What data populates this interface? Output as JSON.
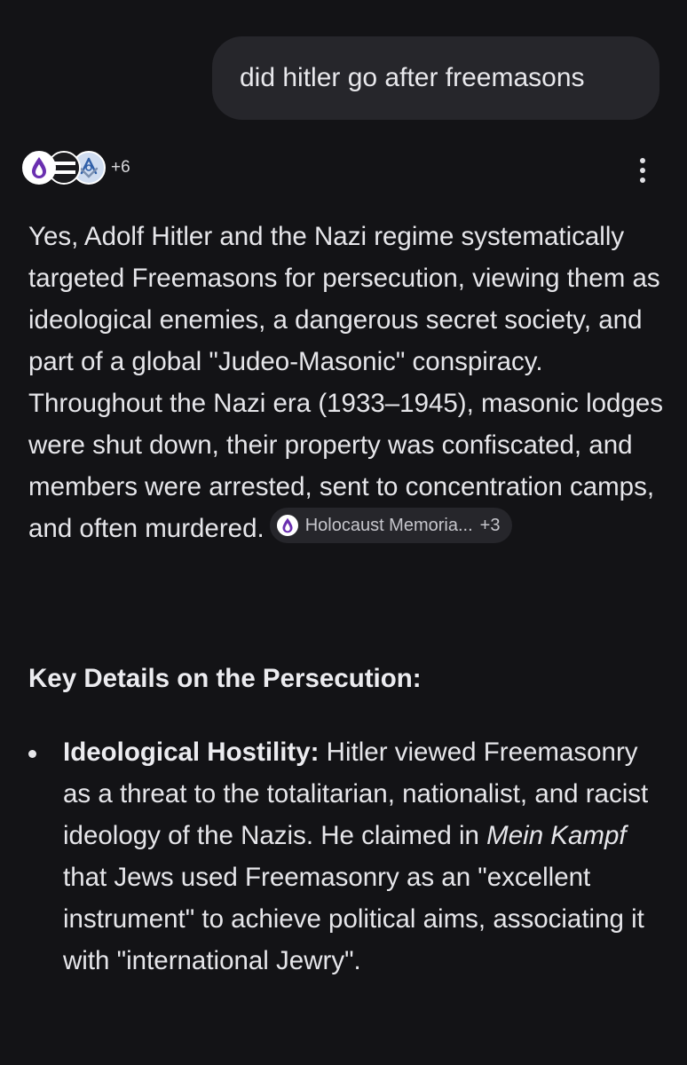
{
  "user_message": "did hitler go after freemasons",
  "sources": {
    "icons": [
      "holocaust-memorial-flame",
      "striped-flag",
      "masonic-square-compass"
    ],
    "more_count": "+6"
  },
  "answer": {
    "paragraph": "Yes, Adolf Hitler and the Nazi regime systematically targeted Freemasons for persecution, viewing them as ideological enemies, a dangerous secret society, and part of a global \"Judeo-Masonic\" conspiracy. Throughout the Nazi era (1933–1945), masonic lodges were shut down, their property was confiscated, and members were arrested, sent to concentration camps, and often murdered.",
    "citation": {
      "label": "Holocaust Memoria...",
      "count": "+3"
    }
  },
  "section": {
    "heading": "Key Details on the Persecution:",
    "bullets": [
      {
        "title": "Ideological Hostility:",
        "text_1": " Hitler viewed Freemasonry as a threat to the totalitarian, nationalist, and racist ideology of the Nazis. He claimed in ",
        "italic": "Mein Kampf",
        "text_2": " that Jews used Freemasonry as an \"excellent instrument\" to achieve political aims, associating it with \"international Jewry\"."
      }
    ]
  },
  "colors": {
    "background": "#131316",
    "bubble": "#26262b",
    "text": "#e6e6ea",
    "flame_purple": "#6a2fb0"
  }
}
